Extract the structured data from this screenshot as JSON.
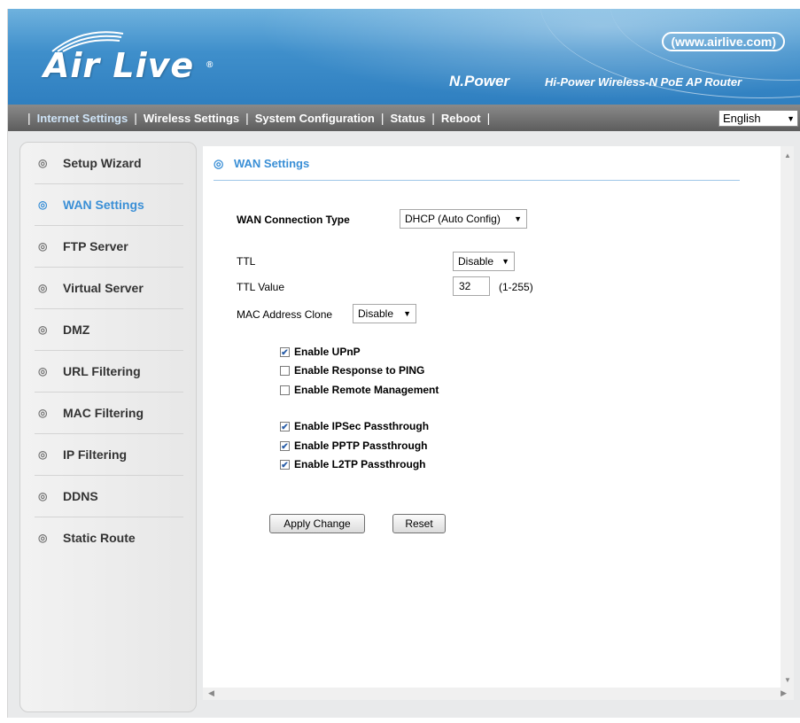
{
  "header": {
    "logo_text": "Air Live",
    "logo_reg": "®",
    "site_url": "(www.airlive.com)",
    "brand": "N.Power",
    "product": "Hi-Power Wireless-N PoE AP Router"
  },
  "nav": {
    "separator": "|",
    "items": [
      "Internet Settings",
      "Wireless Settings",
      "System Configuration",
      "Status",
      "Reboot"
    ],
    "active": "Internet Settings",
    "language": "English"
  },
  "sidebar": {
    "items": [
      {
        "label": "Setup Wizard"
      },
      {
        "label": "WAN Settings"
      },
      {
        "label": "FTP Server"
      },
      {
        "label": "Virtual Server"
      },
      {
        "label": "DMZ"
      },
      {
        "label": "URL Filtering"
      },
      {
        "label": "MAC Filtering"
      },
      {
        "label": "IP Filtering"
      },
      {
        "label": "DDNS"
      },
      {
        "label": "Static Route"
      }
    ],
    "active": "WAN Settings"
  },
  "content": {
    "title": "WAN Settings",
    "wan_connection_type_label": "WAN Connection Type",
    "wan_connection_type_value": "DHCP (Auto Config)",
    "ttl_label": "TTL",
    "ttl_value": "Disable",
    "ttl_value_label": "TTL Value",
    "ttl_value_input": "32",
    "ttl_range": "(1-255)",
    "mac_clone_label": "MAC Address Clone",
    "mac_clone_value": "Disable",
    "checkboxes": [
      {
        "label": "Enable UPnP",
        "checked": true
      },
      {
        "label": "Enable Response to PING",
        "checked": false
      },
      {
        "label": "Enable Remote Management",
        "checked": false
      },
      {
        "label": "Enable IPSec Passthrough",
        "checked": true
      },
      {
        "label": "Enable PPTP Passthrough",
        "checked": true
      },
      {
        "label": "Enable L2TP Passthrough",
        "checked": true
      }
    ],
    "apply_button": "Apply Change",
    "reset_button": "Reset"
  },
  "icons": {
    "bullet": "◎",
    "check": "✔",
    "dropdown": "▼"
  },
  "colors": {
    "accent": "#3a8fd6",
    "header_blue": "#3f8fcb",
    "nav_gray": "#6e6e6e"
  }
}
